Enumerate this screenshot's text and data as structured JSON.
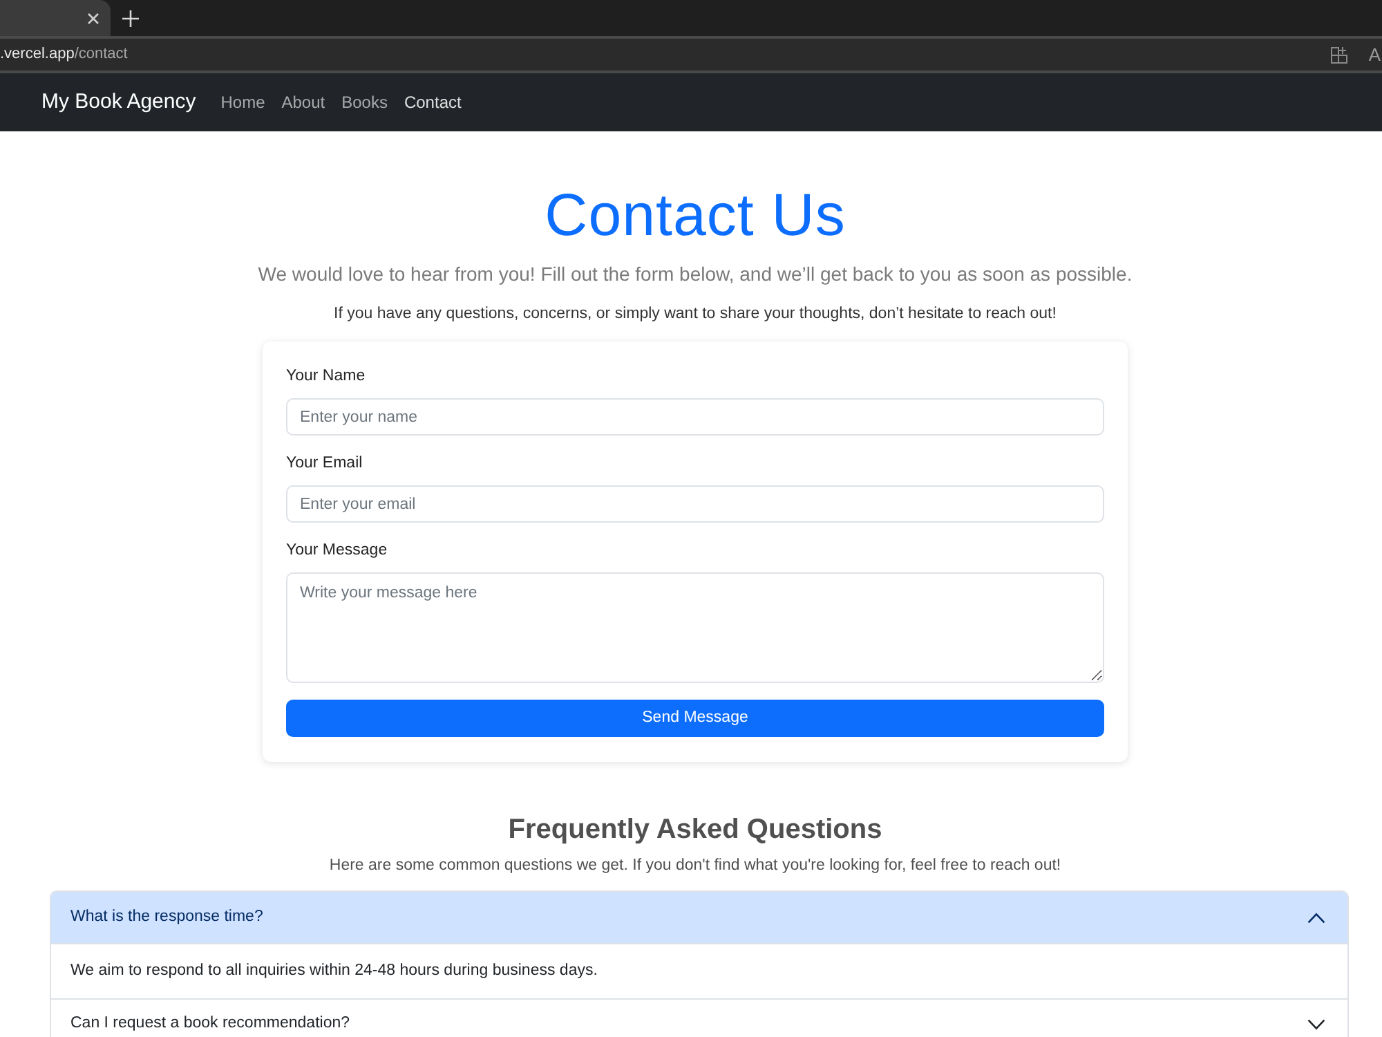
{
  "browser": {
    "address_host": ".vercel.app",
    "address_path": "/contact",
    "toolbar_glyph": "A"
  },
  "navbar": {
    "brand": "My Book Agency",
    "links": [
      {
        "label": "Home",
        "selected": false
      },
      {
        "label": "About",
        "selected": false
      },
      {
        "label": "Books",
        "selected": false
      },
      {
        "label": "Contact",
        "selected": true
      }
    ]
  },
  "header": {
    "title": "Contact Us",
    "lead": "We would love to hear from you! Fill out the form below, and we’ll get back to you as soon as possible.",
    "note": "If you have any questions, concerns, or simply want to share your thoughts, don’t hesitate to reach out!"
  },
  "form": {
    "fields": [
      {
        "kind": "input",
        "label": "Your Name",
        "placeholder": "Enter your name"
      },
      {
        "kind": "input",
        "label": "Your Email",
        "placeholder": "Enter your email"
      },
      {
        "kind": "textarea",
        "label": "Your Message",
        "placeholder": "Write your message here"
      }
    ],
    "submit": "Send Message"
  },
  "faq": {
    "title": "Frequently Asked Questions",
    "intro": "Here are some common questions we get. If you don't find what you're looking for, feel free to reach out!",
    "items": [
      {
        "question": "What is the response time?",
        "expanded": true,
        "answer": "We aim to respond to all inquiries within 24-48 hours during business days."
      },
      {
        "question": "Can I request a book recommendation?",
        "expanded": false
      }
    ]
  }
}
